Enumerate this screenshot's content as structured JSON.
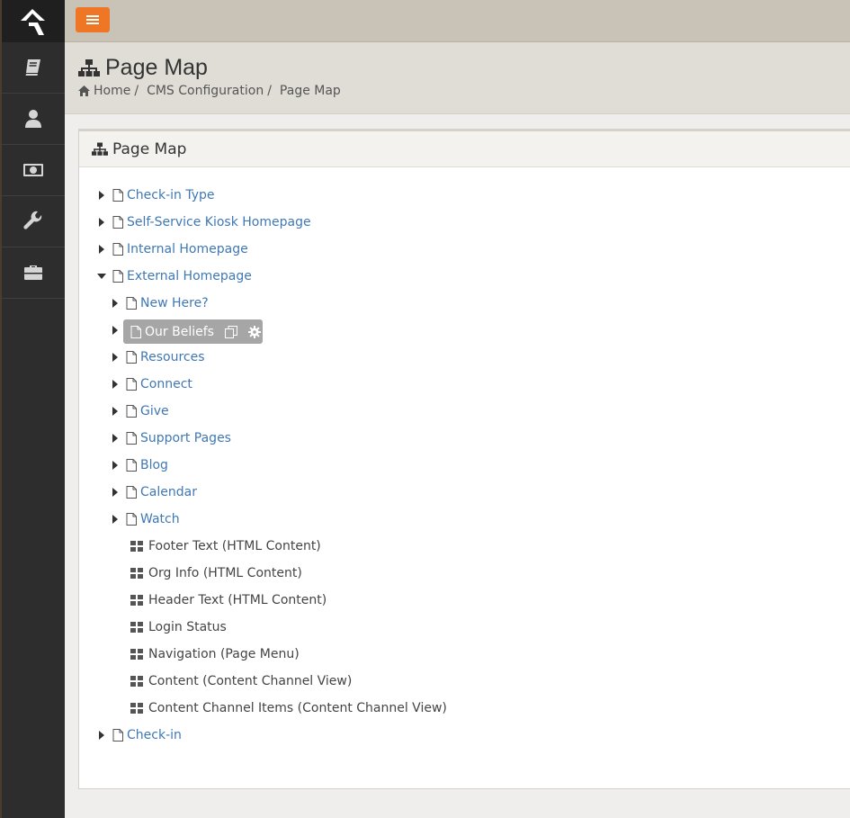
{
  "sidebar": {
    "items": [
      {
        "icon": "book-icon"
      },
      {
        "icon": "user-icon"
      },
      {
        "icon": "money-icon"
      },
      {
        "icon": "wrench-icon"
      },
      {
        "icon": "briefcase-icon"
      }
    ]
  },
  "header": {
    "title": "Page Map",
    "breadcrumb": [
      "Home",
      "CMS Configuration",
      "Page Map"
    ]
  },
  "panel": {
    "title": "Page Map"
  },
  "tree": {
    "top": [
      "Check-in Type",
      "Self-Service Kiosk Homepage",
      "Internal Homepage",
      "External Homepage"
    ],
    "children": [
      "New Here?",
      "Our Beliefs",
      "Resources",
      "Connect",
      "Give",
      "Support Pages",
      "Blog",
      "Calendar",
      "Watch"
    ],
    "blocks": [
      "Footer Text (HTML Content)",
      "Org Info (HTML Content)",
      "Header Text (HTML Content)",
      "Login Status",
      "Navigation (Page Menu)",
      "Content (Content Channel View)",
      "Content Channel Items (Content Channel View)"
    ],
    "bottom": [
      "Check-in"
    ]
  },
  "colors": {
    "accent": "#ee7625",
    "link": "#3f78b5",
    "sidebar": "#2d2d2d"
  }
}
